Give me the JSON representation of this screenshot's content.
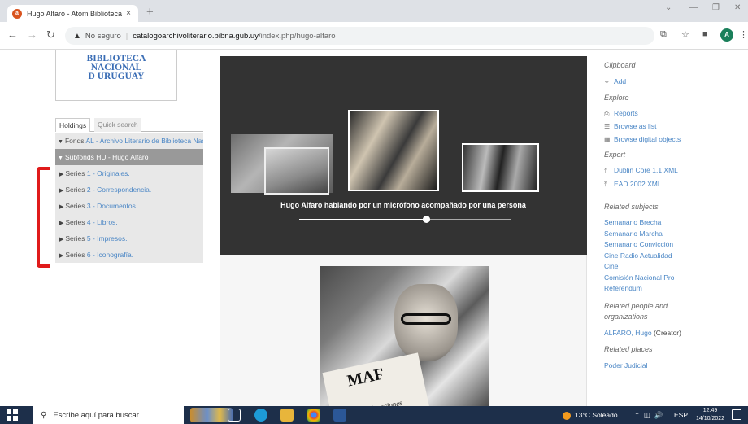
{
  "browser": {
    "tab_title": "Hugo Alfaro - Atom Biblioteca N",
    "tab_favicon": "a",
    "tab_close": "×",
    "new_tab": "+",
    "security_label": "No seguro",
    "url_host": "catalogoarchivoliterario.bibna.gub.uy",
    "url_path": "/index.php/hugo-alfaro",
    "profile_initial": "A"
  },
  "logo": {
    "line1": "BIBLIOTECA",
    "line2": "NACIONAL",
    "line3": "D URUGUAY"
  },
  "treeview": {
    "tabs": [
      {
        "label": "Holdings"
      },
      {
        "label": "Quick search"
      }
    ],
    "rows": [
      {
        "level": "Fonds",
        "title": "AL - Archivo Literario de Biblioteca Nacional",
        "expanded": true
      },
      {
        "level": "Subfonds",
        "title": "HU - Hugo Alfaro",
        "expanded": true,
        "active": true
      },
      {
        "level": "Series",
        "title": "1 - Originales."
      },
      {
        "level": "Series",
        "title": "2 - Correspondencia."
      },
      {
        "level": "Series",
        "title": "3 - Documentos."
      },
      {
        "level": "Series",
        "title": "4 - Libros."
      },
      {
        "level": "Series",
        "title": "5 - Impresos."
      },
      {
        "level": "Series",
        "title": "6 - Iconografía."
      }
    ]
  },
  "carousel": {
    "caption": "Hugo Alfaro hablando por un micrófono acompañado por una persona",
    "slider_position": 0.6
  },
  "main_photo": {
    "text1": "MAF",
    "text2": "Exploraciones"
  },
  "sidebar": {
    "clipboard_heading": "Clipboard",
    "add_label": "Add",
    "explore_heading": "Explore",
    "reports_label": "Reports",
    "browse_list_label": "Browse as list",
    "browse_digital_label": "Browse digital objects",
    "export_heading": "Export",
    "dublin_core_label": "Dublin Core 1.1 XML",
    "ead_label": "EAD 2002 XML",
    "related_subjects_heading": "Related subjects",
    "subjects": [
      "Semanario Brecha",
      "Semanario Marcha",
      "Semanario Convicción",
      "Cine Radio Actualidad",
      "Cine",
      "Comisión Nacional Pro Referéndum"
    ],
    "related_people_heading": "Related people and organizations",
    "person_name": "ALFARO, Hugo",
    "person_role": "(Creator)",
    "related_places_heading": "Related places",
    "place": "Poder Judicial"
  },
  "taskbar": {
    "search_placeholder": "Escribe aquí para buscar",
    "weather": "13°C  Soleado",
    "language": "ESP",
    "time": "12:49",
    "date": "14/10/2022"
  }
}
